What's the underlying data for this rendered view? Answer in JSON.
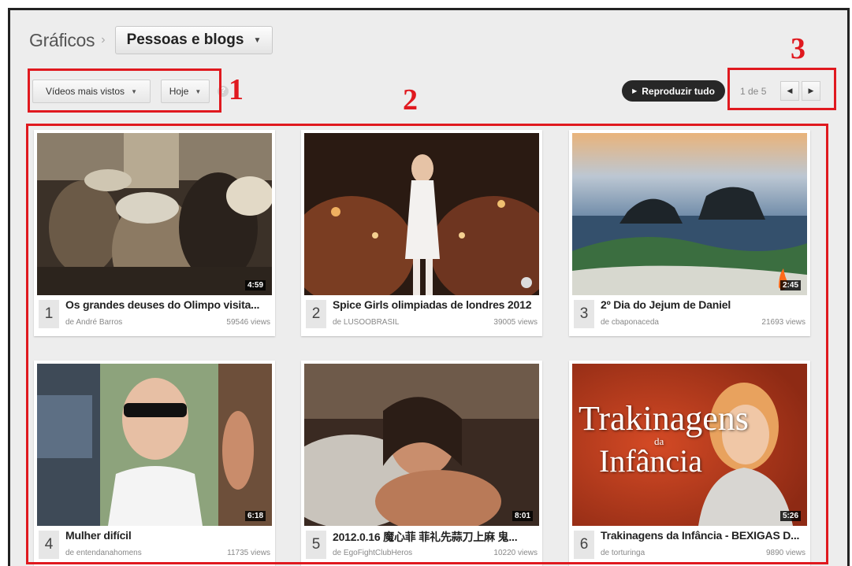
{
  "header": {
    "breadcrumb_root": "Gráficos",
    "category": "Pessoas e blogs"
  },
  "filters": {
    "sort": "Vídeos mais vistos",
    "period": "Hoje"
  },
  "toolbar": {
    "play_all": "Reproduzir tudo",
    "page_info": "1 de 5"
  },
  "annotations": {
    "label1": "1",
    "label2": "2",
    "label3": "3",
    "color": "#e0191f"
  },
  "videos": [
    {
      "rank": "1",
      "title": "Os grandes deuses do Olimpo visita...",
      "channel": "de André Barros",
      "views": "59546 views",
      "duration": "4:59"
    },
    {
      "rank": "2",
      "title": "Spice Girls olimpiadas de londres 2012",
      "channel": "de LUSOOBRASIL",
      "views": "39005 views",
      "duration": ""
    },
    {
      "rank": "3",
      "title": "2º Dia do Jejum de Daniel",
      "channel": "de cbaponaceda",
      "views": "21693 views",
      "duration": "2:45"
    },
    {
      "rank": "4",
      "title": "Mulher difícil",
      "channel": "de entendanahomens",
      "views": "11735 views",
      "duration": "6:18"
    },
    {
      "rank": "5",
      "title": "2012.0.16 魔心菲 菲礼先蒜刀上麻 鬼...",
      "channel": "de EgoFightClubHeros",
      "views": "10220 views",
      "duration": "8:01"
    },
    {
      "rank": "6",
      "title": "Trakinagens da Infância - BEXIGAS D...",
      "channel": "de torturinga",
      "views": "9890 views",
      "duration": "5:26"
    }
  ],
  "thumb6_text": {
    "line1": "Trakinagens",
    "line2": "da",
    "line3": "Infância"
  }
}
